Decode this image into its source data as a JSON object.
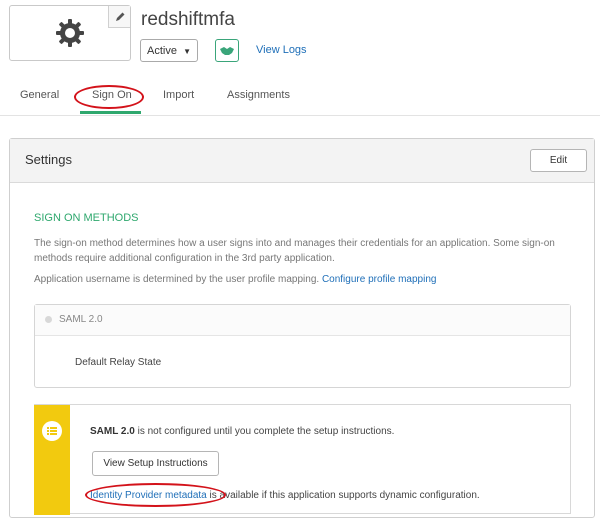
{
  "app": {
    "name": "redshiftmfa",
    "status": "Active",
    "view_logs": "View Logs"
  },
  "tabs": [
    {
      "label": "General"
    },
    {
      "label": "Sign On"
    },
    {
      "label": "Import"
    },
    {
      "label": "Assignments"
    }
  ],
  "active_tab": "Sign On",
  "settings": {
    "title": "Settings",
    "edit_label": "Edit",
    "section_title": "SIGN ON METHODS",
    "description": "The sign-on method determines how a user signs into and manages their credentials for an application. Some sign-on methods require additional configuration in the 3rd party application.",
    "username_text": "Application username is determined by the user profile mapping.",
    "username_link": "Configure profile mapping",
    "saml_option": "SAML 2.0",
    "relay_state_label": "Default Relay State",
    "notice": {
      "bold": "SAML 2.0",
      "text": " is not configured until you complete the setup instructions.",
      "button": "View Setup Instructions",
      "metadata_link": "Identity Provider metadata",
      "metadata_text": " is available if this application supports dynamic configuration."
    }
  },
  "colors": {
    "accent_green": "#2fa86e",
    "link_blue": "#1f6fb8",
    "notice_yellow": "#f2ca0f",
    "annotation_red": "#d3121a"
  }
}
